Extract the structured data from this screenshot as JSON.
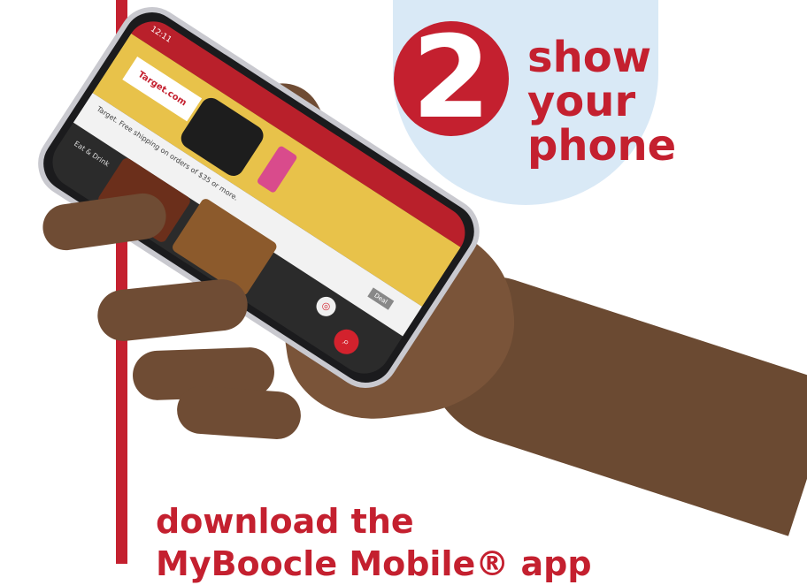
{
  "step": {
    "number": "2",
    "title_lines": [
      "show",
      "your",
      "phone"
    ]
  },
  "bottom": {
    "lines": [
      "download the",
      "MyBoocle Mobile® app"
    ]
  },
  "phone_ui": {
    "status_time": "12:11",
    "banner_brand": "Target.com",
    "promo_text": "Target. Free shipping on orders of $35 or more.",
    "promo_button": "Deal",
    "section_label": "Eat & Drink",
    "fab_icon": "search-icon",
    "fab2_icon": "target-icon"
  },
  "colors": {
    "accent": "#c4202f",
    "circle_bg": "#d9e9f6",
    "skin": "#7a5439"
  }
}
